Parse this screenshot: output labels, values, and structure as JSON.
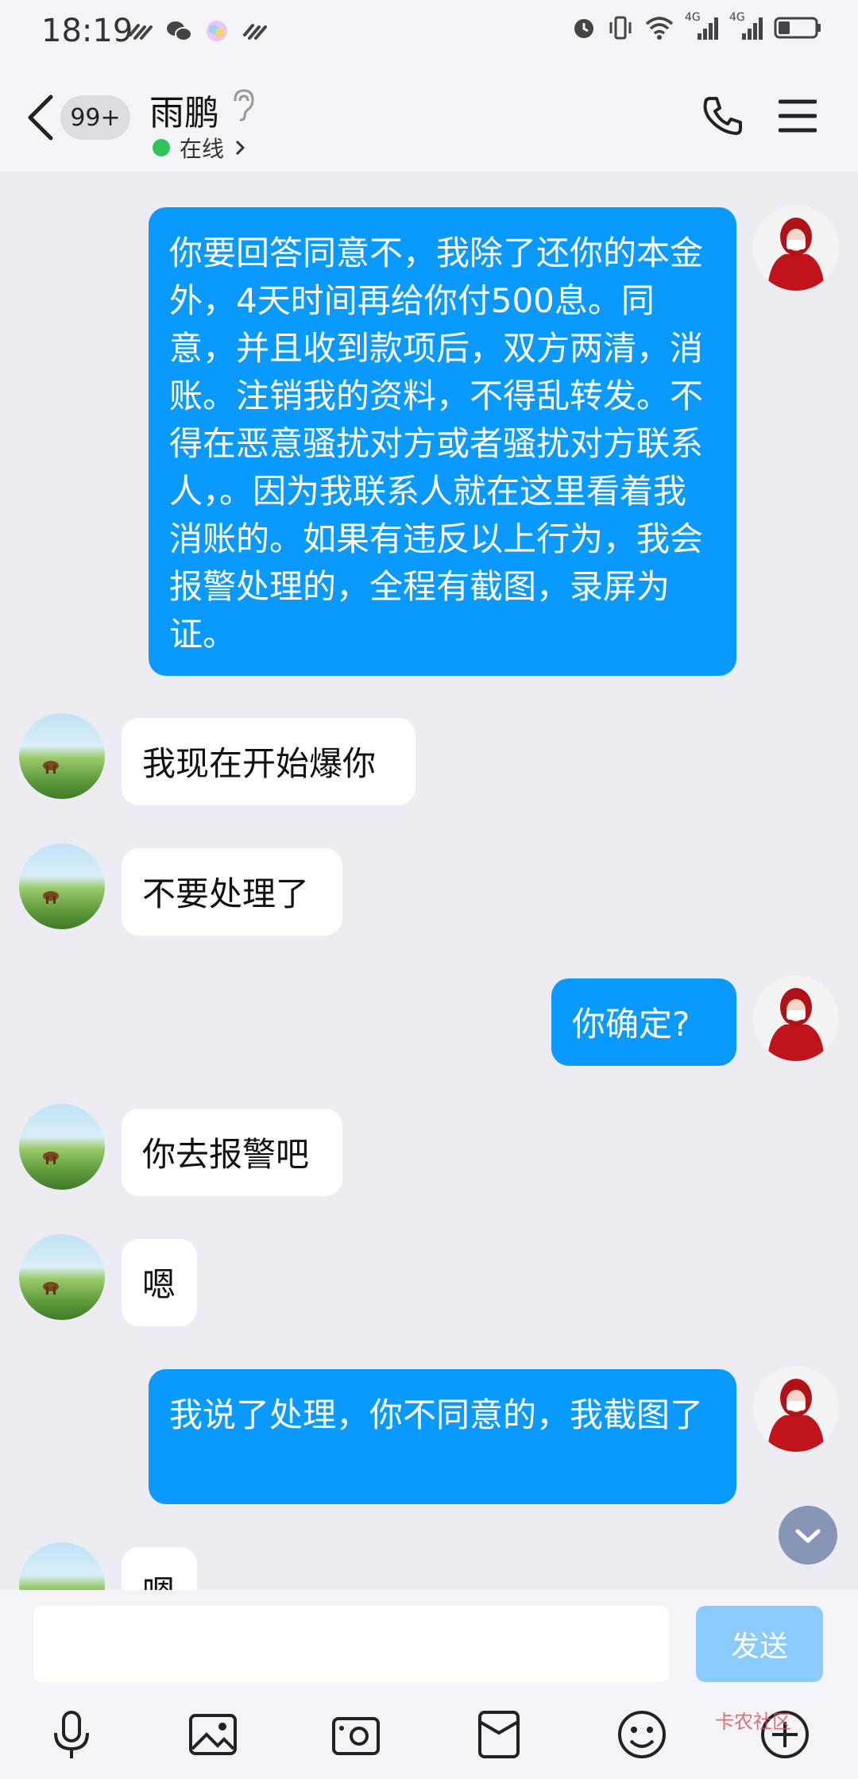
{
  "statusbar": {
    "time": "18:19",
    "net1": "4G",
    "net2": "4G"
  },
  "header": {
    "badge": "99+",
    "name": "雨鹏",
    "status": "在线"
  },
  "messages": [
    {
      "from": "me",
      "text": "你要回答同意不，我除了还你的本金外，4天时间再给你付500息。同意，并且收到款项后，双方两清，消账。注销我的资料，不得乱转发。不得在恶意骚扰对方或者骚扰对方联系人，。因为我联系人就在这里看着我消账的。如果有违反以上行为，我会报警处理的，全程有截图，录屏为证。"
    },
    {
      "from": "them",
      "text": "我现在开始爆你"
    },
    {
      "from": "them",
      "text": "不要处理了"
    },
    {
      "from": "me",
      "text": "你确定?"
    },
    {
      "from": "them",
      "text": "你去报警吧"
    },
    {
      "from": "them",
      "text": "嗯"
    },
    {
      "from": "me",
      "text": "我说了处理，你不同意的，我截图了"
    },
    {
      "from": "them",
      "text": "嗯"
    }
  ],
  "input": {
    "value": "",
    "send_label": "发送"
  },
  "toolbar": [
    "mic-icon",
    "image-icon",
    "camera-icon",
    "red-packet-icon",
    "emoji-icon",
    "plus-icon"
  ],
  "watermark": "卡农社区"
}
